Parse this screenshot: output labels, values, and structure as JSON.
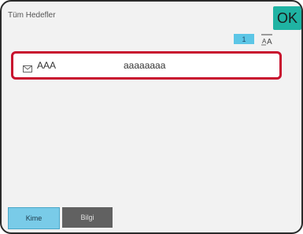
{
  "header": {
    "title": "Tüm Hedefler",
    "ok_label": "OK"
  },
  "toolbar": {
    "page_number": "1",
    "sort_icon": "sort-alpha-icon"
  },
  "list": {
    "items": [
      {
        "icon": "mail-icon",
        "name": "AAA",
        "address": "aaaaaaaa"
      }
    ]
  },
  "footer": {
    "tabs": [
      {
        "label": "Kime",
        "selected": true
      },
      {
        "label": "Bilgi",
        "selected": false
      }
    ]
  },
  "colors": {
    "accent_ok": "#1fb3a3",
    "selection_border": "#c8102e",
    "tab_selected": "#79cbe8",
    "tab_unselected": "#616161"
  }
}
